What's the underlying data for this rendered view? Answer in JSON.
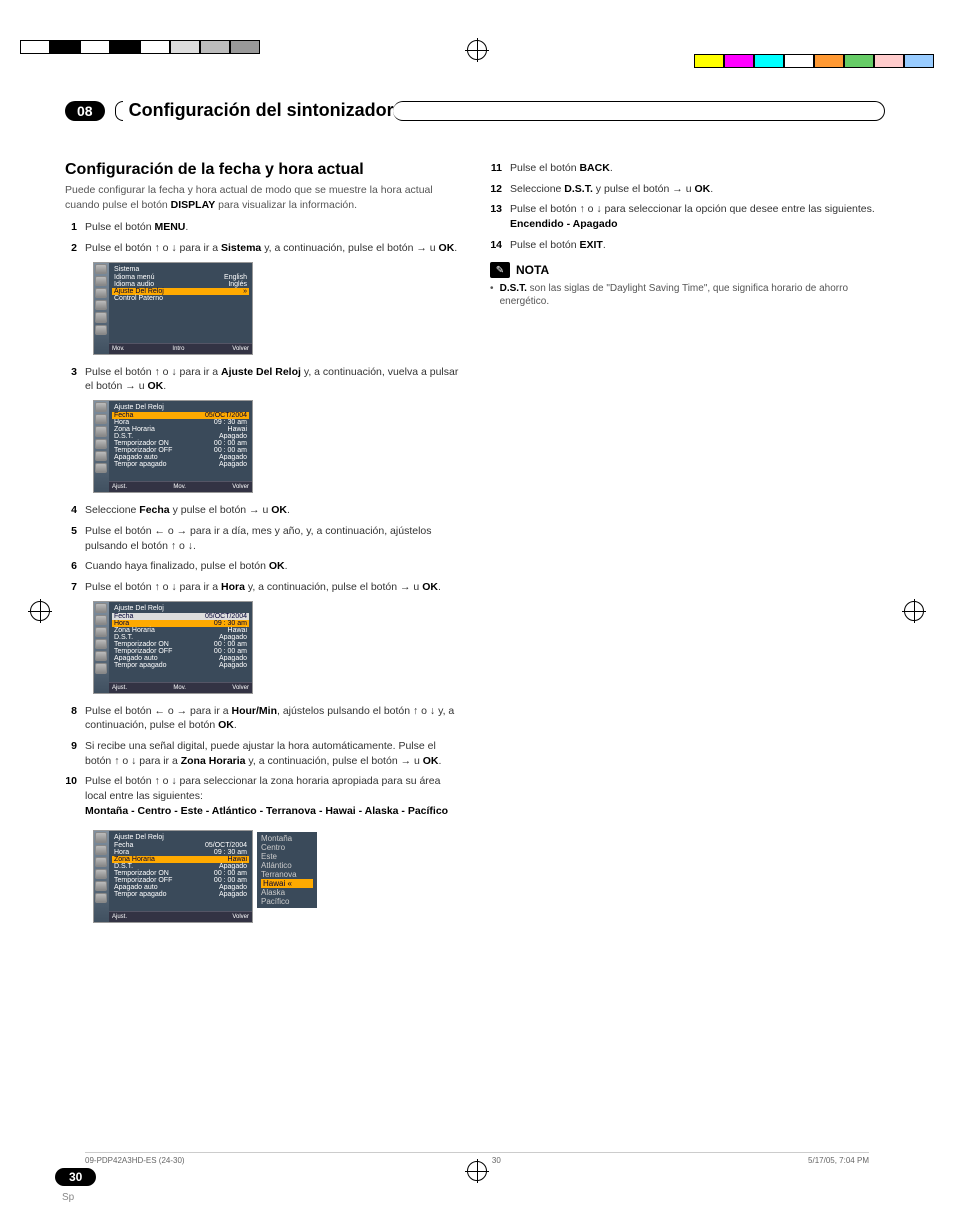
{
  "chapter": {
    "num": "08",
    "title": "Configuración del sintonizador"
  },
  "section_title": "Configuración de la fecha y hora actual",
  "intro_a": "Puede configurar la fecha y hora actual de modo que se muestre la hora actual cuando pulse el botón ",
  "intro_b": "DISPLAY",
  "intro_c": " para visualizar la información.",
  "steps_left": {
    "1": {
      "t": "Pulse el botón ",
      "b": "MENU",
      "t2": "."
    },
    "2": {
      "t": "Pulse el botón ↑ o ↓ para ir a ",
      "b": "Sistema",
      "t2": " y, a continuación, pulse el botón → u ",
      "b2": "OK",
      "t3": "."
    },
    "3": {
      "t": "Pulse el botón ↑ o ↓ para ir a ",
      "b": "Ajuste Del Reloj",
      "t2": " y, a continuación, vuelva a pulsar el botón → u ",
      "b2": "OK",
      "t3": "."
    },
    "4": {
      "t": "Seleccione ",
      "b": "Fecha",
      "t2": " y pulse el botón → u ",
      "b2": "OK",
      "t3": "."
    },
    "5": {
      "t": "Pulse el botón ← o → para ir a día, mes y año, y, a continuación, ajústelos pulsando el botón ↑ o ↓."
    },
    "6": {
      "t": "Cuando haya finalizado, pulse el botón ",
      "b": "OK",
      "t2": "."
    },
    "7": {
      "t": "Pulse el botón ↑ o ↓ para ir a ",
      "b": "Hora",
      "t2": " y, a continuación, pulse el botón → u ",
      "b2": "OK",
      "t3": "."
    },
    "8": {
      "t": "Pulse el botón ← o → para ir a ",
      "b": "Hour/Min",
      "t2": ", ajústelos pulsando el botón ↑ o ↓ y, a continuación, pulse el botón ",
      "b2": "OK",
      "t3": "."
    },
    "9": {
      "t": "Si recibe una señal digital, puede ajustar la hora automáticamente. Pulse el botón ↑ o ↓ para ir a ",
      "b": "Zona Horaria",
      "t2": " y, a continuación, pulse el botón → u ",
      "b2": "OK",
      "t3": "."
    },
    "10": {
      "t": "Pulse el botón ↑ o ↓ para seleccionar la zona horaria apropiada para su área local entre las siguientes:",
      "b": "Montaña - Centro - Este - Atlántico - Terranova - Hawai - Alaska - Pacífico"
    }
  },
  "steps_right": {
    "11": {
      "t": "Pulse el botón ",
      "b": "BACK",
      "t2": "."
    },
    "12": {
      "t": "Seleccione ",
      "b": "D.S.T.",
      "t2": " y pulse el botón → u ",
      "b2": "OK",
      "t3": "."
    },
    "13": {
      "t": "Pulse el botón ↑ o ↓ para seleccionar la opción que desee entre las siguientes.",
      "b": "Encendido - Apagado"
    },
    "14": {
      "t": "Pulse el botón ",
      "b": "EXIT",
      "t2": "."
    }
  },
  "note": {
    "label": "NOTA",
    "body_b": "D.S.T.",
    "body": " son las siglas de \"Daylight Saving Time\", que significa horario de ahorro energético."
  },
  "osd1": {
    "title": "Sistema",
    "rows": [
      [
        "Idioma menú",
        "English"
      ],
      [
        "Idioma audio",
        "Inglés"
      ],
      [
        "Ajuste Del Reloj",
        ""
      ],
      [
        "Control Paterno",
        ""
      ]
    ],
    "footer": [
      "Mov.",
      "Intro",
      "Volver"
    ]
  },
  "osd2": {
    "title": "Ajuste Del Reloj",
    "rows": [
      [
        "Fecha",
        "05/OCT/2004"
      ],
      [
        "Hora",
        "09 : 30 am"
      ],
      [
        "Zona Horaria",
        "Hawai"
      ],
      [
        "D.S.T.",
        "Apagado"
      ],
      [
        "Temporizador ON",
        "00 : 00 am"
      ],
      [
        "Temporizador OFF",
        "00 : 00 am"
      ],
      [
        "Apagado auto",
        "Apagado"
      ],
      [
        "Tempor apagado",
        "Apagado"
      ]
    ],
    "footer": [
      "Ajust.",
      "Mov.",
      "Volver"
    ],
    "sel_index": 0
  },
  "osd3": {
    "title": "Ajuste Del Reloj",
    "rows": [
      [
        "Fecha",
        "05/OCT/2004"
      ],
      [
        "Hora",
        "09 : 30 am"
      ],
      [
        "Zona Horaria",
        "Hawai"
      ],
      [
        "D.S.T.",
        "Apagado"
      ],
      [
        "Temporizador ON",
        "00 : 00 am"
      ],
      [
        "Temporizador OFF",
        "00 : 00 am"
      ],
      [
        "Apagado auto",
        "Apagado"
      ],
      [
        "Tempor apagado",
        "Apagado"
      ]
    ],
    "footer": [
      "Ajust.",
      "Mov.",
      "Volver"
    ],
    "sel_index": 1
  },
  "osd4": {
    "title": "Ajuste Del Reloj",
    "rows": [
      [
        "Fecha",
        "05/OCT/2004"
      ],
      [
        "Hora",
        "09 : 30 am"
      ],
      [
        "Zona Horaria",
        "Hawai"
      ],
      [
        "D.S.T.",
        "Apagado"
      ],
      [
        "Temporizador ON",
        "00 : 00 am"
      ],
      [
        "Temporizador OFF",
        "00 : 00 am"
      ],
      [
        "Apagado auto",
        "Apagado"
      ],
      [
        "Tempor apagado",
        "Apagado"
      ]
    ],
    "footer": [
      "Ajust.",
      "Volver"
    ],
    "sel_index": 2,
    "side": [
      "Montaña",
      "Centro",
      "Este",
      "Atlántico",
      "Terranova",
      "Hawai",
      "Alaska",
      "Pacífico"
    ],
    "side_sel": 5
  },
  "page_num": "30",
  "page_lang": "Sp",
  "footer": {
    "left": "09-PDP42A3HD-ES (24-30)",
    "center": "30",
    "right": "5/17/05, 7:04 PM"
  }
}
